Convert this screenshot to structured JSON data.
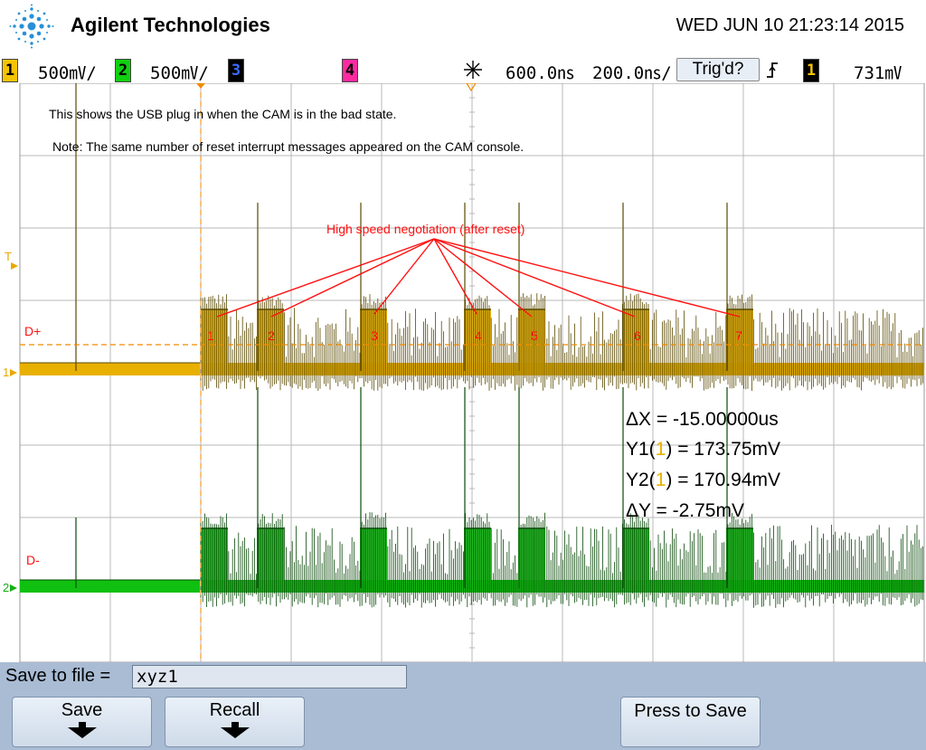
{
  "header": {
    "brand": "Agilent Technologies",
    "datetime": "WED JUN 10 21:23:14 2015"
  },
  "status": {
    "ch1_num": "1",
    "ch1_scale": "500㎷/",
    "ch2_num": "2",
    "ch2_scale": "500㎷/",
    "ch3_num": "3",
    "ch4_num": "4",
    "time_delay": "600.0㎱",
    "time_scale": "200.0㎱/",
    "trigger_status": "Trig'd?",
    "trig_source_num": "1",
    "trig_level": "731㎷",
    "colors": {
      "ch1": "#f5c400",
      "ch2": "#10d010",
      "ch3": "#3a6cff",
      "ch4": "#ff2aa0"
    }
  },
  "screen": {
    "note1": "This shows the USB plug in when the CAM is in the bad state.",
    "note2": "Note: The same number of reset interrupt messages appeared on the CAM console.",
    "annotation": "High speed negotiation (after reset)",
    "dplus_label": "D+",
    "dminus_label": "D-",
    "trigger_marker": "T",
    "ch1_marker": "1",
    "ch2_marker": "2",
    "burst_numbers": [
      "1",
      "2",
      "3",
      "4",
      "5",
      "6",
      "7"
    ],
    "measurements": {
      "dx": "ΔX = -15.00000us",
      "y1_pre": "Y1(",
      "y1_ch": "1",
      "y1_post": ") = 173.75mV",
      "y2_pre": "Y2(",
      "y2_ch": "1",
      "y2_post": ") = 170.94mV",
      "dy": "ΔY = -2.75mV"
    }
  },
  "softkeys": {
    "save_to_file_label": "Save to file =",
    "filename": "xyz1",
    "save": "Save",
    "recall": "Recall",
    "press_to_save": "Press to Save"
  }
}
